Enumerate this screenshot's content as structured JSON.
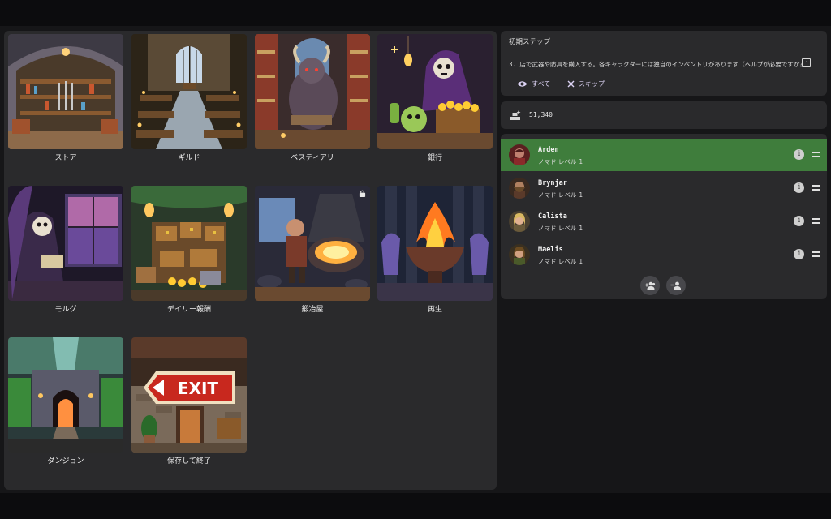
{
  "locations": [
    {
      "label": "ストア",
      "icon": "store-icon"
    },
    {
      "label": "ギルド",
      "icon": "guild-icon"
    },
    {
      "label": "ベスティアリ",
      "icon": "bestiary-icon"
    },
    {
      "label": "銀行",
      "icon": "bank-icon"
    },
    {
      "label": "モルグ",
      "icon": "morgue-icon"
    },
    {
      "label": "デイリー報酬",
      "icon": "daily-reward-icon"
    },
    {
      "label": "鍛冶屋",
      "icon": "blacksmith-icon",
      "locked": true
    },
    {
      "label": "再生",
      "icon": "regenerate-icon"
    },
    {
      "label": "ダンジョン",
      "icon": "dungeon-icon"
    },
    {
      "label": "保存して終了",
      "icon": "save-exit-icon",
      "sign": "EXIT"
    }
  ],
  "steps": {
    "title": "初期ステップ",
    "text": "3. 店で武器や防具を購入する。各キャラクターには独自のインベントリがあります（ヘルプが必要ですか？）",
    "all_label": "すべて",
    "skip_label": "スキップ"
  },
  "gold": {
    "value": "51,340",
    "icon": "gold-bars-icon"
  },
  "party": [
    {
      "name": "Arden",
      "class_level": "ノマド レベル",
      "level": "1",
      "active": true
    },
    {
      "name": "Brynjar",
      "class_level": "ノマド レベル",
      "level": "1",
      "active": false
    },
    {
      "name": "Calista",
      "class_level": "ノマド レベル",
      "level": "1",
      "active": false
    },
    {
      "name": "Maelis",
      "class_level": "ノマド レベル",
      "level": "1",
      "active": false
    }
  ],
  "colors": {
    "accent": "#3f7d3c",
    "panel": "#2a2a2c",
    "link": "#dcd3f4"
  }
}
